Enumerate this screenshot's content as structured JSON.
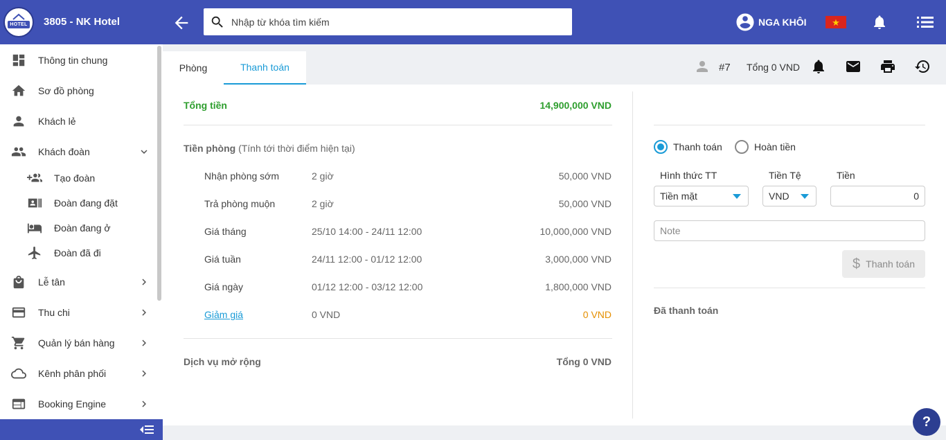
{
  "header": {
    "logo_text": "HOTEL",
    "hotel_name": "3805 - NK Hotel",
    "search_placeholder": "Nhập từ khóa tìm kiếm",
    "user_name": "NGA KHÔI",
    "flag_symbol": "★"
  },
  "sidebar": {
    "items": [
      {
        "label": "Thông tin chung",
        "icon": "dashboard-icon"
      },
      {
        "label": "Sơ đồ phòng",
        "icon": "home-icon"
      },
      {
        "label": "Khách lẻ",
        "icon": "person-icon"
      },
      {
        "label": "Khách đoàn",
        "icon": "group-icon",
        "expanded": true
      },
      {
        "label": "Lễ tân",
        "icon": "shopping-bag-icon"
      },
      {
        "label": "Thu chi",
        "icon": "credit-card-icon"
      },
      {
        "label": "Quản lý bán hàng",
        "icon": "cart-icon"
      },
      {
        "label": "Kênh phân phối",
        "icon": "cloud-icon"
      },
      {
        "label": "Booking Engine",
        "icon": "web-icon"
      }
    ],
    "sub_items": [
      {
        "label": "Tạo đoàn",
        "icon": "group-add-icon"
      },
      {
        "label": "Đoàn đang đặt",
        "icon": "id-card-icon"
      },
      {
        "label": "Đoàn đang ở",
        "icon": "hotel-bed-icon"
      },
      {
        "label": "Đoàn đã đi",
        "icon": "airplane-icon"
      }
    ]
  },
  "tabs": {
    "room": "Phòng",
    "payment": "Thanh toán",
    "booking_number": "#7",
    "booking_total": "Tổng 0 VND"
  },
  "summary": {
    "total_label": "Tổng tiền",
    "total_value": "14,900,000 VND",
    "room_fee_title": "Tiền phòng",
    "room_fee_note": "(Tính tới thời điểm hiện tại)",
    "rows": [
      {
        "label": "Nhận phòng sớm",
        "detail": "2 giờ",
        "amount": "50,000 VND"
      },
      {
        "label": "Trả phòng muộn",
        "detail": "2 giờ",
        "amount": "50,000 VND"
      },
      {
        "label": "Giá tháng",
        "detail": "25/10 14:00 - 24/11 12:00",
        "amount": "10,000,000 VND"
      },
      {
        "label": "Giá tuần",
        "detail": "24/11 12:00 - 01/12 12:00",
        "amount": "3,000,000 VND"
      },
      {
        "label": "Giá ngày",
        "detail": "01/12 12:00 - 03/12 12:00",
        "amount": "1,800,000 VND"
      }
    ],
    "discount_label": "Giảm giá",
    "discount_detail": "0 VND",
    "discount_amount": "0 VND",
    "services_label": "Dịch vụ mở rộng",
    "services_total": "Tổng 0 VND"
  },
  "payment": {
    "radio_pay": "Thanh toán",
    "radio_refund": "Hoàn tiền",
    "method_label": "Hình thức TT",
    "currency_label": "Tiền Tệ",
    "amount_label": "Tiền",
    "method_value": "Tiền mặt",
    "currency_value": "VND",
    "amount_value": "0",
    "note_placeholder": "Note",
    "pay_button": "Thanh toán",
    "paid_label": "Đã thanh toán"
  },
  "help_label": "?",
  "colors": {
    "brand": "#3f51b5",
    "accent": "#1a9bd7",
    "total_green": "#2e9e2e",
    "discount_orange": "#e58f00"
  }
}
